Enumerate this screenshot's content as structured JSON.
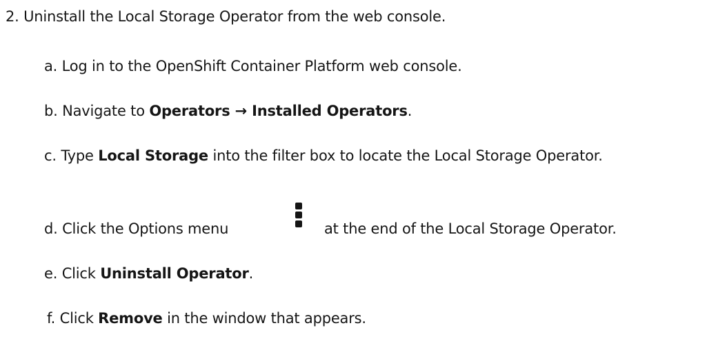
{
  "step": {
    "number": "2.",
    "title": "Uninstall the Local Storage Operator from the web console."
  },
  "substeps": [
    {
      "marker": "a.",
      "text": "Log in to the OpenShift Container Platform web console."
    },
    {
      "marker": "b.",
      "prefix": "Navigate to ",
      "bold": "Operators → Installed Operators",
      "suffix": "."
    },
    {
      "marker": "c.",
      "prefix": "Type ",
      "bold": "Local Storage",
      "suffix": " into the filter box to locate the Local Storage Operator."
    },
    {
      "marker": "d.",
      "prefix": "Click the Options menu",
      "icon": "kebab-menu-icon",
      "suffix": "at the end of the Local Storage Operator."
    },
    {
      "marker": "e.",
      "prefix": "Click ",
      "bold": "Uninstall Operator",
      "suffix": "."
    },
    {
      "marker": "f.",
      "prefix": "Click ",
      "bold": "Remove",
      "suffix": " in the window that appears."
    }
  ]
}
